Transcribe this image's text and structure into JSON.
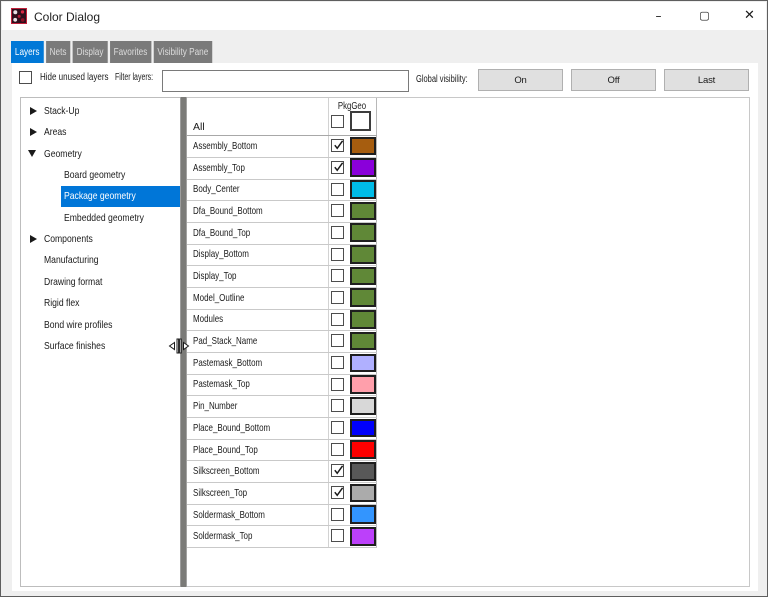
{
  "window": {
    "title": "Color Dialog",
    "controls": {
      "minimize": "–",
      "maximize": "▢",
      "close": "✕"
    }
  },
  "accent": {
    "tab_selected": "#0078d7",
    "tree_selection": "#0076d8"
  },
  "tabs": [
    {
      "label": "Layers",
      "selected": true
    },
    {
      "label": "Nets",
      "selected": false
    },
    {
      "label": "Display",
      "selected": false
    },
    {
      "label": "Favorites",
      "selected": false
    },
    {
      "label": "Visibility Pane",
      "selected": false
    }
  ],
  "filter_row": {
    "hide_unused_label": "Hide unused layers",
    "hide_unused_checked": false,
    "filter_label": "Filter layers:",
    "filter_value": "",
    "global_label": "Global visibility:",
    "buttons": [
      "On",
      "Off",
      "Last"
    ]
  },
  "tree": {
    "items": [
      {
        "label": "Stack-Up",
        "level": 0,
        "arrow": "collapsed",
        "selected": false
      },
      {
        "label": "Areas",
        "level": 0,
        "arrow": "collapsed",
        "selected": false
      },
      {
        "label": "Geometry",
        "level": 0,
        "arrow": "expanded",
        "selected": false
      },
      {
        "label": "Board geometry",
        "level": 1,
        "arrow": null,
        "selected": false
      },
      {
        "label": "Package geometry",
        "level": 1,
        "arrow": null,
        "selected": true
      },
      {
        "label": "Embedded geometry",
        "level": 1,
        "arrow": null,
        "selected": false
      },
      {
        "label": "Components",
        "level": 0,
        "arrow": "collapsed",
        "selected": false
      },
      {
        "label": "Manufacturing",
        "level": 0,
        "arrow": null,
        "selected": false
      },
      {
        "label": "Drawing format",
        "level": 0,
        "arrow": null,
        "selected": false
      },
      {
        "label": "Rigid flex",
        "level": 0,
        "arrow": null,
        "selected": false
      },
      {
        "label": "Bond wire profiles",
        "level": 0,
        "arrow": null,
        "selected": false
      },
      {
        "label": "Surface finishes",
        "level": 0,
        "arrow": null,
        "selected": false
      }
    ]
  },
  "table": {
    "group_header": "PkgGeo",
    "all_label": "All",
    "all_checkbox_checked": false,
    "all_color_checkbox_checked": false,
    "rows": [
      {
        "name": "Assembly_Bottom",
        "checked": true,
        "color": "#a65d0f"
      },
      {
        "name": "Assembly_Top",
        "checked": true,
        "color": "#8a00da"
      },
      {
        "name": "Body_Center",
        "checked": false,
        "color": "#00bce8"
      },
      {
        "name": "Dfa_Bound_Bottom",
        "checked": false,
        "color": "#608837"
      },
      {
        "name": "Dfa_Bound_Top",
        "checked": false,
        "color": "#608837"
      },
      {
        "name": "Display_Bottom",
        "checked": false,
        "color": "#608837"
      },
      {
        "name": "Display_Top",
        "checked": false,
        "color": "#608837"
      },
      {
        "name": "Model_Outline",
        "checked": false,
        "color": "#608837"
      },
      {
        "name": "Modules",
        "checked": false,
        "color": "#608837"
      },
      {
        "name": "Pad_Stack_Name",
        "checked": false,
        "color": "#608837"
      },
      {
        "name": "Pastemask_Bottom",
        "checked": false,
        "color": "#b0b0ff"
      },
      {
        "name": "Pastemask_Top",
        "checked": false,
        "color": "#ff9fab"
      },
      {
        "name": "Pin_Number",
        "checked": false,
        "color": "#d8d8d8"
      },
      {
        "name": "Place_Bound_Bottom",
        "checked": false,
        "color": "#0000fc"
      },
      {
        "name": "Place_Bound_Top",
        "checked": false,
        "color": "#fd0000"
      },
      {
        "name": "Silkscreen_Bottom",
        "checked": true,
        "color": "#585858"
      },
      {
        "name": "Silkscreen_Top",
        "checked": true,
        "color": "#ababab"
      },
      {
        "name": "Soldermask_Bottom",
        "checked": false,
        "color": "#3395fe"
      },
      {
        "name": "Soldermask_Top",
        "checked": false,
        "color": "#bc40fa"
      }
    ]
  }
}
